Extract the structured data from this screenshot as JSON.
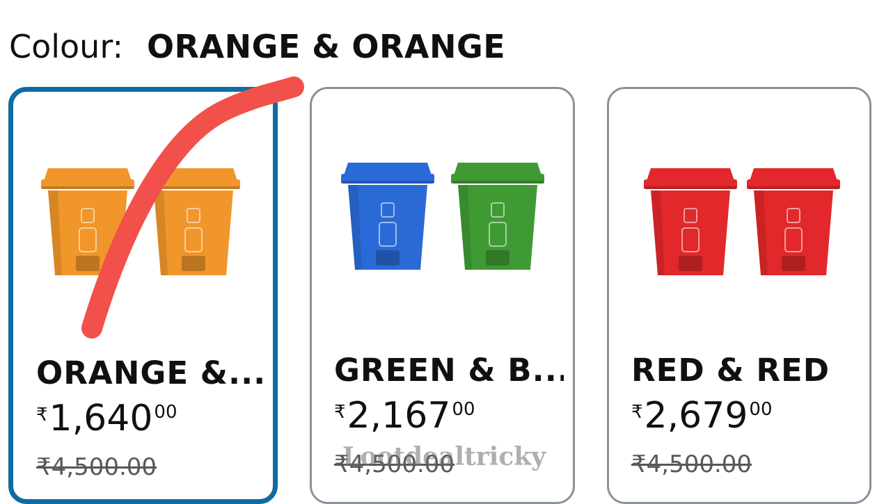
{
  "colour": {
    "label": "Colour:",
    "value": "ORANGE & ORANGE"
  },
  "options": [
    {
      "title": "ORANGE &...",
      "price_symbol": "₹",
      "price_whole": "1,640",
      "price_fraction": "00",
      "mrp": "₹4,500.00",
      "selected": true,
      "bin_colors": [
        "#f0962a",
        "#f0962a"
      ]
    },
    {
      "title": "GREEN & B...",
      "price_symbol": "₹",
      "price_whole": "2,167",
      "price_fraction": "00",
      "mrp": "₹4,500.00",
      "selected": false,
      "bin_colors": [
        "#2a6ad6",
        "#3f9a34"
      ]
    },
    {
      "title": "RED & RED",
      "price_symbol": "₹",
      "price_whole": "2,679",
      "price_fraction": "00",
      "mrp": "₹4,500.00",
      "selected": false,
      "bin_colors": [
        "#e2282a",
        "#e2282a"
      ]
    }
  ],
  "watermark": "Lootdealtricky",
  "colors": {
    "selected_border": "#0f6ba3",
    "card_border": "#8d9096",
    "annotation_stroke": "#f2504a"
  }
}
